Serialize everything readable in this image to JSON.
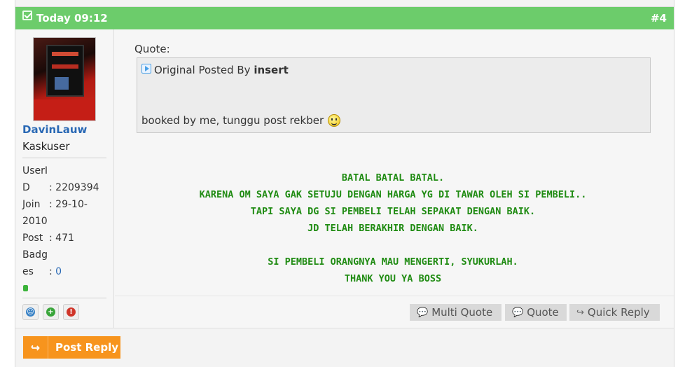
{
  "post": {
    "date": "Today 09:12",
    "number": "#4"
  },
  "user": {
    "name": "DavinLauw",
    "title": "Kaskuser",
    "stats": [
      {
        "k": "UserI",
        "v": ""
      },
      {
        "k": "D",
        "v": ": 2209394"
      },
      {
        "k": "Join",
        "v": ": 29-10-"
      },
      {
        "k": "2010",
        "v": ""
      },
      {
        "k": "Post",
        "v": ": 471"
      },
      {
        "k": "Badg",
        "v": ""
      },
      {
        "k": "es",
        "v": ": ",
        "badge": "0"
      }
    ],
    "buttons": [
      {
        "icon": "profile-icon",
        "color": "#3b83c6",
        "glyph": "☺"
      },
      {
        "icon": "add-reputation-icon",
        "color": "#39a53a",
        "glyph": "+"
      },
      {
        "icon": "report-icon",
        "color": "#d0352a",
        "glyph": "!"
      }
    ]
  },
  "quote": {
    "label": "Quote:",
    "posted_by_prefix": "Original Posted By ",
    "author": "insert",
    "text": "booked by me, tunggu post rekber"
  },
  "message": {
    "lines": [
      "BATAL BATAL BATAL.",
      "KARENA OM SAYA GAK SETUJU DENGAN HARGA YG DI TAWAR OLEH SI PEMBELI..",
      "TAPI SAYA DG SI PEMBELI TELAH SEPAKAT DENGAN BAIK.",
      "JD TELAH BERAKHIR DENGAN BAIK.",
      "",
      "SI PEMBELI ORANGNYA MAU MENGERTI, SYUKURLAH.",
      "THANK YOU YA BOSS"
    ],
    "color": "#1f8b12"
  },
  "actions": {
    "multi_quote": "Multi Quote",
    "quote": "Quote",
    "quick_reply": "Quick Reply"
  },
  "post_reply": "Post Reply",
  "colors": {
    "header": "#6ccc6b",
    "accent": "#f7941d",
    "link": "#2a69b5"
  }
}
